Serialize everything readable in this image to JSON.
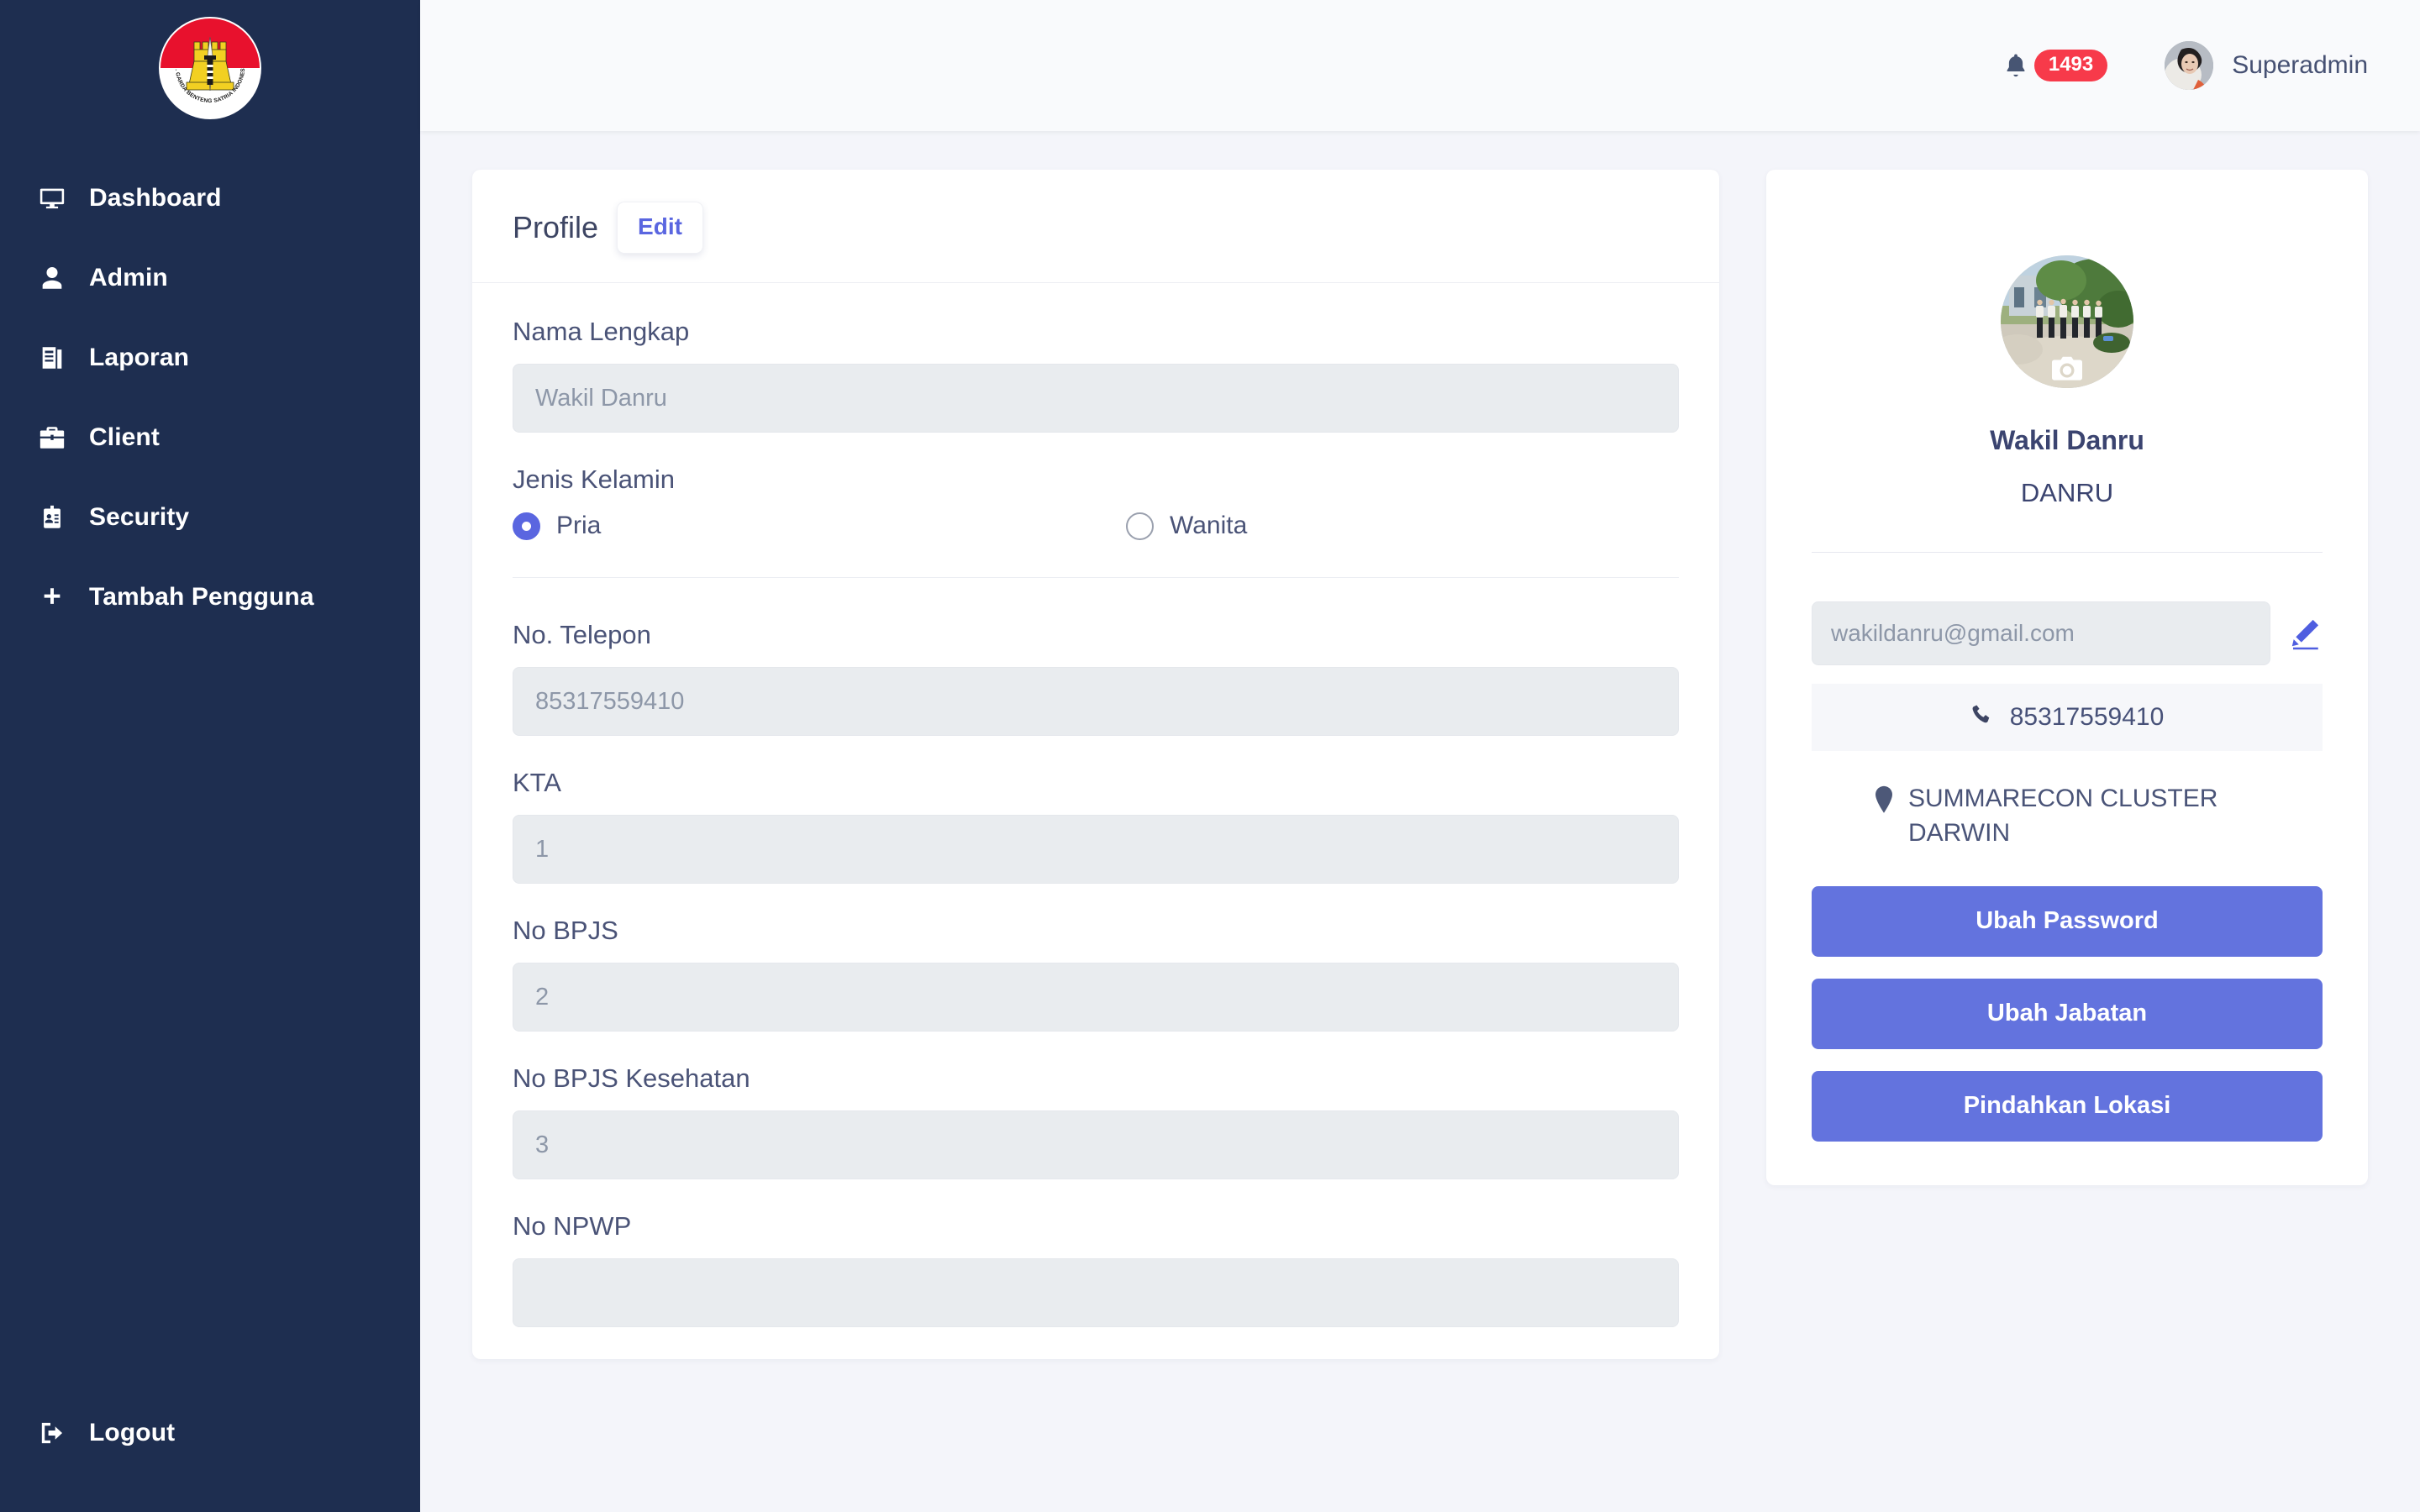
{
  "sidebar": {
    "logo": {
      "alt": "PT. GARDA BENTENG SATRIA INDONESIA",
      "ring_text": "PT. GARDA BENTENG SATRIA INDONESIA"
    },
    "items": [
      {
        "label": "Dashboard",
        "icon": "monitor-icon"
      },
      {
        "label": "Admin",
        "icon": "user-icon"
      },
      {
        "label": "Laporan",
        "icon": "document-icon"
      },
      {
        "label": "Client",
        "icon": "briefcase-icon"
      },
      {
        "label": "Security",
        "icon": "id-badge-icon"
      },
      {
        "label": "Tambah Pengguna",
        "icon": "plus-icon"
      }
    ],
    "logout": {
      "label": "Logout",
      "icon": "logout-icon"
    }
  },
  "topbar": {
    "notification_count": "1493",
    "bell_icon": "bell-icon",
    "user_name": "Superadmin"
  },
  "profile": {
    "title": "Profile",
    "edit_label": "Edit",
    "fields": [
      {
        "label": "Nama Lengkap",
        "value": "Wakil Danru",
        "placeholder": "Wakil Danru"
      },
      {
        "label": "No. Telepon",
        "value": "85317559410",
        "placeholder": "85317559410"
      },
      {
        "label": "KTA",
        "value": "1",
        "placeholder": "1"
      },
      {
        "label": "No BPJS",
        "value": "2",
        "placeholder": "2"
      },
      {
        "label": "No BPJS Kesehatan",
        "value": "3",
        "placeholder": "3"
      },
      {
        "label": "No NPWP",
        "value": "",
        "placeholder": ""
      }
    ],
    "gender": {
      "label": "Jenis Kelamin",
      "options": [
        {
          "label": "Pria",
          "selected": true
        },
        {
          "label": "Wanita",
          "selected": false
        }
      ]
    }
  },
  "summary": {
    "avatar_alt": "profile-photo",
    "camera_icon": "camera-icon",
    "name": "Wakil Danru",
    "role": "DANRU",
    "email": "wakildanru@gmail.com",
    "email_edit_icon": "pencil-icon",
    "phone": "85317559410",
    "phone_icon": "phone-icon",
    "location": "SUMMARECON CLUSTER DARWIN",
    "location_icon": "map-pin-icon",
    "buttons": [
      {
        "label": "Ubah Password"
      },
      {
        "label": "Ubah Jabatan"
      },
      {
        "label": "Pindahkan Lokasi"
      }
    ]
  },
  "colors": {
    "sidebar_bg": "#1e2e50",
    "accent_blue": "#6373de",
    "link_blue": "#5a66e0",
    "badge_red": "#f73a4a",
    "input_bg": "#e9ecef",
    "page_bg": "#f4f5fa"
  }
}
